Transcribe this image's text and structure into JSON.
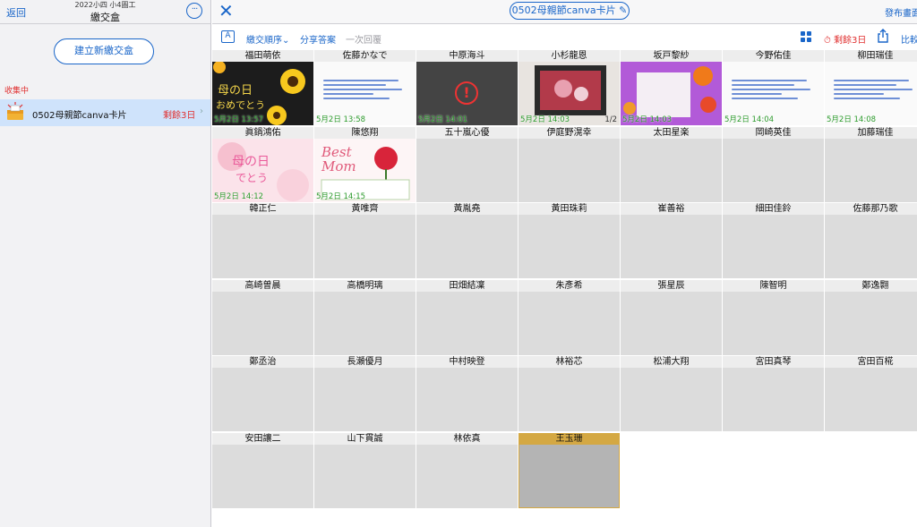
{
  "sidebar": {
    "back_label": "返回",
    "subtitle": "2022小四 小4圖工",
    "title": "繳交盒",
    "more_glyph": "···",
    "new_box_label": "建立新繳交盒",
    "section_label": "收集中",
    "box": {
      "name": "0502母親節canva卡片",
      "remaining": "剩餘3日",
      "chevron": "›"
    }
  },
  "topbar": {
    "close_glyph": "✕",
    "title": "0502母親節canva卡片",
    "edit_glyph": "✎",
    "publish_label": "發布畫面"
  },
  "toolbar": {
    "text_icon_glyph": "A",
    "sort_label": "繳交順序",
    "sort_chevron": "⌄",
    "share_answer_label": "分享答案",
    "reply_label": "一次回覆",
    "remaining_label": "剩餘3日",
    "compare_label": "比較"
  },
  "colors": {
    "accent": "#1a66c9",
    "warning": "#e03030",
    "time_green": "#2b9a2b",
    "selected": "#d4a843"
  },
  "cells": [
    {
      "name": "福田萌依",
      "time": "5月2日 13:57",
      "thumb": "flower"
    },
    {
      "name": "佐藤かなで",
      "time": "5月2日 13:58",
      "thumb": "doc"
    },
    {
      "name": "中原海斗",
      "time": "5月2日 14:01",
      "thumb": "error"
    },
    {
      "name": "小杉龍恩",
      "time": "5月2日 14:03",
      "thumb": "screen",
      "page": "1/2"
    },
    {
      "name": "坂戸黎紗",
      "time": "5月2日 14:03",
      "thumb": "purple"
    },
    {
      "name": "今野佑佳",
      "time": "5月2日 14:04",
      "thumb": "doc"
    },
    {
      "name": "柳田瑞佳",
      "time": "5月2日 14:08",
      "thumb": "doc"
    },
    {
      "name": "眞鍋鴻佑",
      "time": "5月2日 14:12",
      "thumb": "pink"
    },
    {
      "name": "陳悠翔",
      "time": "5月2日 14:15",
      "thumb": "best"
    },
    {
      "name": "五十嵐心優"
    },
    {
      "name": "伊庭野滉幸"
    },
    {
      "name": "太田星楽"
    },
    {
      "name": "岡崎英佳"
    },
    {
      "name": "加藤瑞佳"
    },
    {
      "name": "韓正仁"
    },
    {
      "name": "黃唯齊"
    },
    {
      "name": "黃胤堯"
    },
    {
      "name": "黃田珠莉"
    },
    {
      "name": "崔善裕"
    },
    {
      "name": "細田佳鈴"
    },
    {
      "name": "佐藤那乃歌"
    },
    {
      "name": "高崎曽晨"
    },
    {
      "name": "高橋明璃"
    },
    {
      "name": "田畑結凜"
    },
    {
      "name": "朱彥希"
    },
    {
      "name": "張星辰"
    },
    {
      "name": "陳智明"
    },
    {
      "name": "鄭逸翾"
    },
    {
      "name": "鄭丞治"
    },
    {
      "name": "長瀬優月"
    },
    {
      "name": "中村映登"
    },
    {
      "name": "林裕芯"
    },
    {
      "name": "松浦大翔"
    },
    {
      "name": "宮田真琴"
    },
    {
      "name": "宮田百椛"
    },
    {
      "name": "安田讓二"
    },
    {
      "name": "山下貫誠"
    },
    {
      "name": "林依真"
    },
    {
      "name": "王玉珊",
      "selected": true
    }
  ]
}
